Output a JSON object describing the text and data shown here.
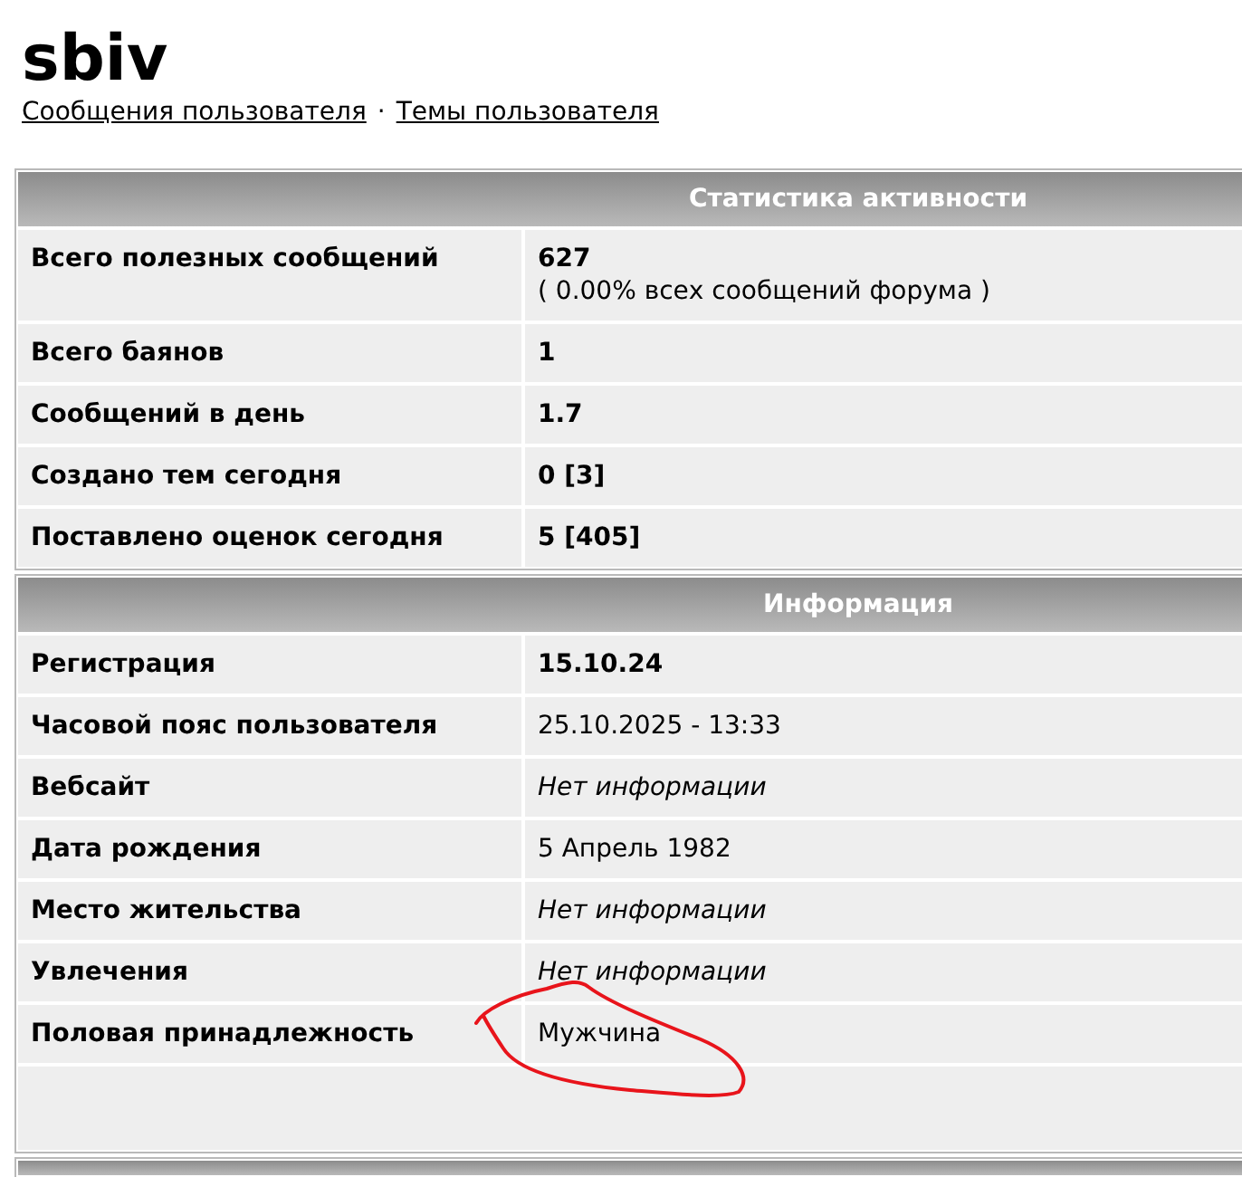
{
  "user": {
    "name": "sbiv"
  },
  "links": [
    {
      "label": "Сообщения пользователя"
    },
    {
      "label": "Темы пользователя"
    }
  ],
  "link_separator": "·",
  "sections": [
    {
      "title": "Статистика активности",
      "cut_off": false,
      "empty_footer": false,
      "rows": [
        {
          "label": "Всего полезных сообщений",
          "value": "627",
          "note": "( 0.00% всех сообщений форума )",
          "kind": "strong",
          "circled": false
        },
        {
          "label": "Всего баянов",
          "value": "1",
          "kind": "strong",
          "circled": false
        },
        {
          "label": "Сообщений в день",
          "value": "1.7",
          "kind": "strong",
          "circled": false
        },
        {
          "label": "Создано тем сегодня",
          "value": "0 [3]",
          "kind": "strong",
          "circled": false
        },
        {
          "label": "Поставлено оценок сегодня",
          "value": "5 [405]",
          "kind": "strong",
          "circled": false
        }
      ]
    },
    {
      "title": "Информация",
      "cut_off": false,
      "empty_footer": true,
      "rows": [
        {
          "label": "Регистрация",
          "value": "15.10.24",
          "kind": "strong",
          "circled": false
        },
        {
          "label": "Часовой пояс пользователя",
          "value": "25.10.2025 - 13:33",
          "kind": "plain",
          "circled": false
        },
        {
          "label": "Вебсайт",
          "value": "Нет информации",
          "kind": "missing",
          "circled": false
        },
        {
          "label": "Дата рождения",
          "value": "5 Апрель 1982",
          "kind": "plain",
          "circled": false
        },
        {
          "label": "Место жительства",
          "value": "Нет информации",
          "kind": "missing",
          "circled": false
        },
        {
          "label": "Увлечения",
          "value": "Нет информации",
          "kind": "missing",
          "circled": false
        },
        {
          "label": "Половая принадлежность",
          "value": "Мужчина",
          "kind": "plain",
          "circled": true
        }
      ]
    },
    {
      "cut_off": true
    }
  ]
}
